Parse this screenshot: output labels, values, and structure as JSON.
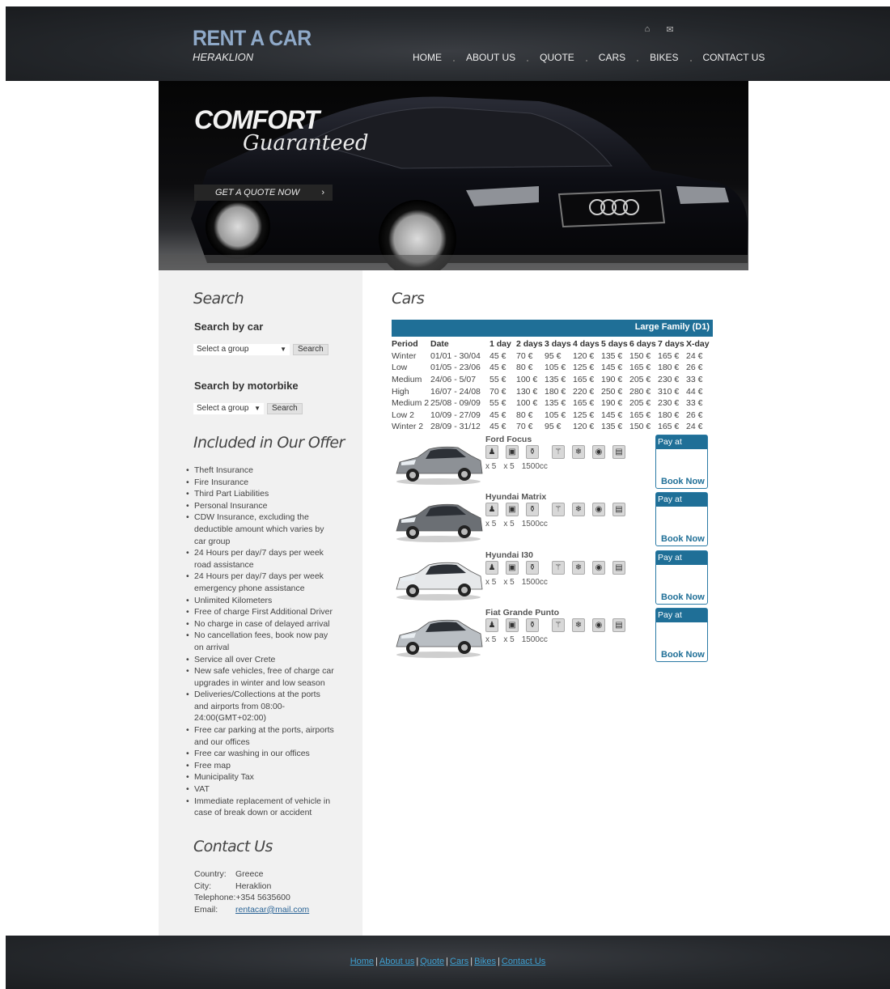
{
  "header": {
    "logo_main": "RENT A CAR",
    "logo_sub": "HERAKLION",
    "nav": [
      "HOME",
      "ABOUT US",
      "QUOTE",
      "CARS",
      "BIKES",
      "CONTACT US"
    ],
    "icons": [
      "home-icon",
      "mail-icon"
    ]
  },
  "hero": {
    "title": "COMFORT",
    "subtitle": "Guaranteed",
    "button_label": "GET A QUOTE NOW",
    "button_arrow": "›"
  },
  "sidebar": {
    "search_title": "Search",
    "search_by_car": "Search by car",
    "car_select": "Select a group",
    "car_search_btn": "Search",
    "search_by_bike": "Search by motorbike",
    "bike_select": "Select a group",
    "bike_search_btn": "Search",
    "offer_title": "Included in Our Offer",
    "offer_items": [
      "Theft Insurance",
      "Fire Insurance",
      "Third Part Liabilities",
      "Personal Insurance",
      "CDW Insurance, excluding the deductible amount which varies by car group",
      "24 Hours per day/7 days per week road assistance",
      "24 Hours per day/7 days per week emergency phone assistance",
      "Unlimited Kilometers",
      "Free of charge First Additional Driver",
      "No charge in case of delayed arrival",
      "No cancellation fees, book now pay on arrival",
      "Service all over Crete",
      "New safe vehicles, free of charge car upgrades in winter and low season",
      "Deliveries/Collections at the ports and airports from 08:00-24:00(GMT+02:00)",
      "Free car parking at the ports, airports and our offices",
      "Free car washing in our offices",
      "Free map",
      "Municipality Tax",
      "VAT",
      "Immediate replacement of vehicle in case of break down or accident"
    ],
    "contact_title": "Contact Us",
    "contact": {
      "country_label": "Country:",
      "country": "Greece",
      "city_label": "City:",
      "city": "Heraklion",
      "phone_label": "Telephone:",
      "phone": "+354 5635600",
      "email_label": "Email:",
      "email": "rentacar@mail.com"
    }
  },
  "main": {
    "title": "Cars",
    "group": "Large Family (D1)",
    "rates_headers": [
      "Period",
      "Date",
      "1 day",
      "2 days",
      "3 days",
      "4 days",
      "5 days",
      "6 days",
      "7 days",
      "X-day"
    ],
    "rates_rows": [
      [
        "Winter",
        "01/01 - 30/04",
        "45 €",
        "70 €",
        "95 €",
        "120 €",
        "135 €",
        "150 €",
        "165 €",
        "24 €"
      ],
      [
        "Low",
        "01/05 - 23/06",
        "45 €",
        "80 €",
        "105 €",
        "125 €",
        "145 €",
        "165 €",
        "180 €",
        "26 €"
      ],
      [
        "Medium",
        "24/06 - 5/07",
        "55 €",
        "100 €",
        "135 €",
        "165 €",
        "190 €",
        "205 €",
        "230 €",
        "33 €"
      ],
      [
        "High",
        "16/07 - 24/08",
        "70 €",
        "130 €",
        "180 €",
        "220 €",
        "250 €",
        "280 €",
        "310 €",
        "44 €"
      ],
      [
        "Medium 2",
        "25/08 - 09/09",
        "55 €",
        "100 €",
        "135 €",
        "165 €",
        "190 €",
        "205 €",
        "230 €",
        "33 €"
      ],
      [
        "Low 2",
        "10/09 - 27/09",
        "45 €",
        "80 €",
        "105 €",
        "125 €",
        "145 €",
        "165 €",
        "180 €",
        "26 €"
      ],
      [
        "Winter 2",
        "28/09 - 31/12",
        "45 €",
        "70 €",
        "95 €",
        "120 €",
        "135 €",
        "150 €",
        "165 €",
        "24 €"
      ]
    ],
    "cars": [
      {
        "name": "Ford Focus",
        "seats": "x 5",
        "doors": "x 5",
        "engine": "1500cc",
        "pay": "Pay at arrival",
        "book": "Book Now",
        "color": "#8d9196"
      },
      {
        "name": "Hyundai Matrix",
        "seats": "x 5",
        "doors": "x 5",
        "engine": "1500cc",
        "pay": "Pay at arrival",
        "book": "Book Now",
        "color": "#6b6f74"
      },
      {
        "name": "Hyundai I30",
        "seats": "x 5",
        "doors": "x 5",
        "engine": "1500cc",
        "pay": "Pay at arrival",
        "book": "Book Now",
        "color": "#e6e8ea"
      },
      {
        "name": "Fiat Grande Punto",
        "seats": "x 5",
        "doors": "x 5",
        "engine": "1500cc",
        "pay": "Pay at arrival",
        "book": "Book Now",
        "color": "#b9bec3"
      }
    ],
    "feature_icons": [
      "person-icon",
      "door-icon",
      "luggage-icon",
      "air-condition-icon",
      "snowflake-icon",
      "cd-icon",
      "radio-icon"
    ]
  },
  "footer": {
    "links": [
      "Home",
      "About us",
      "Quote",
      "Cars",
      "Bikes",
      "Contact Us"
    ]
  },
  "colors": {
    "accent": "#1f6f97",
    "link": "#2a6496",
    "header_bg": "#24272b",
    "sidebar_bg": "#f1f1f1"
  }
}
